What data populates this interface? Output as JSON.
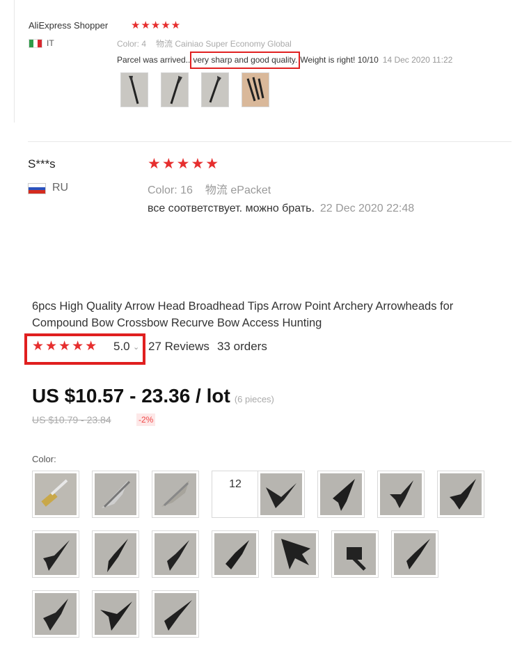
{
  "review_1": {
    "name": "AliExpress Shopper",
    "stars": "★★★★★",
    "country": "IT",
    "color_label": "Color: 4",
    "shipping": "物流 Cainiao Super Economy Global",
    "text_before": "Parcel was arrived..",
    "text_highlight": "very sharp and good quality.",
    "text_after": "Weight is right! 10/10",
    "date": "14 Dec 2020 11:22"
  },
  "review_2": {
    "name": "S***s",
    "stars": "★★★★★",
    "country": "RU",
    "color_label": "Color: 16",
    "shipping": "物流 ePacket",
    "text": "все соответствует. можно брать.",
    "date": "22 Dec 2020 22:48"
  },
  "product": {
    "title": "6pcs High Quality Arrow Head Broadhead Tips Arrow Point Archery Arrowheads for Compound Bow Crossbow Recurve Bow Access Hunting",
    "stars": "★★★★★",
    "rating": "5.0",
    "caret": "⌄",
    "reviews": "27 Reviews",
    "orders": "33 orders",
    "price": "US $10.57 - 23.36 / lot",
    "price_unit": "(6 pieces)",
    "old_price": "US $10.79 - 23.84",
    "discount": "-2%",
    "color_label": "Color:",
    "swatch_text_12": "12"
  },
  "colors": {
    "star": "#e62e2e",
    "highlight_border": "#e02020"
  }
}
